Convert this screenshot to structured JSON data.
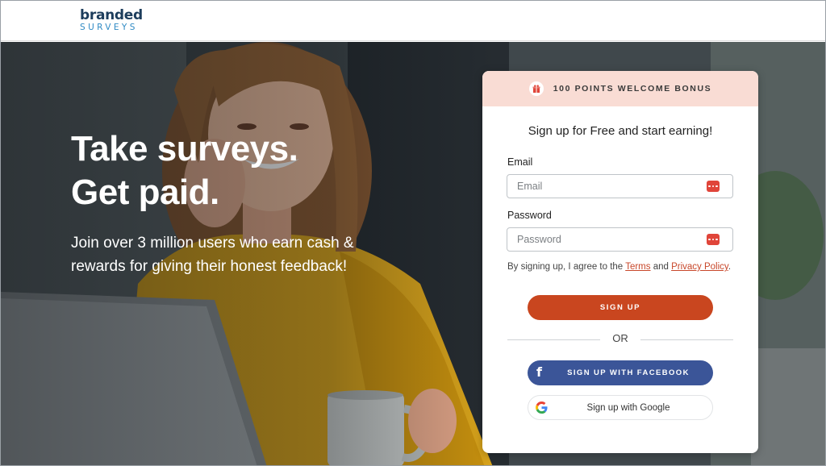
{
  "brand": {
    "line1": "branded",
    "line2": "SURVEYS"
  },
  "hero": {
    "headline_line1": "Take surveys.",
    "headline_line2": "Get paid.",
    "subtext": "Join over 3 million users who earn cash & rewards for giving their honest feedback!"
  },
  "signup": {
    "bonus_text": "100 POINTS WELCOME BONUS",
    "bonus_icon": "gift-icon",
    "title": "Sign up for Free and start earning!",
    "email_label": "Email",
    "email_placeholder": "Email",
    "email_value": "",
    "password_label": "Password",
    "password_placeholder": "Password",
    "password_value": "",
    "password_manager_icon": "password-manager-icon",
    "terms_prefix": "By signing up, I agree to the ",
    "terms_link": "Terms",
    "terms_and": " and ",
    "privacy_link": "Privacy Policy",
    "terms_suffix": ".",
    "signup_button": "SIGN UP",
    "or_text": "OR",
    "facebook_button": "SIGN UP WITH FACEBOOK",
    "google_button": "Sign up with Google"
  },
  "colors": {
    "accent": "#c9461f",
    "bonus_bg": "#f9dcd4",
    "facebook": "#3b5598",
    "brand_dark": "#1d3d5c",
    "brand_light": "#2f8ac4"
  }
}
